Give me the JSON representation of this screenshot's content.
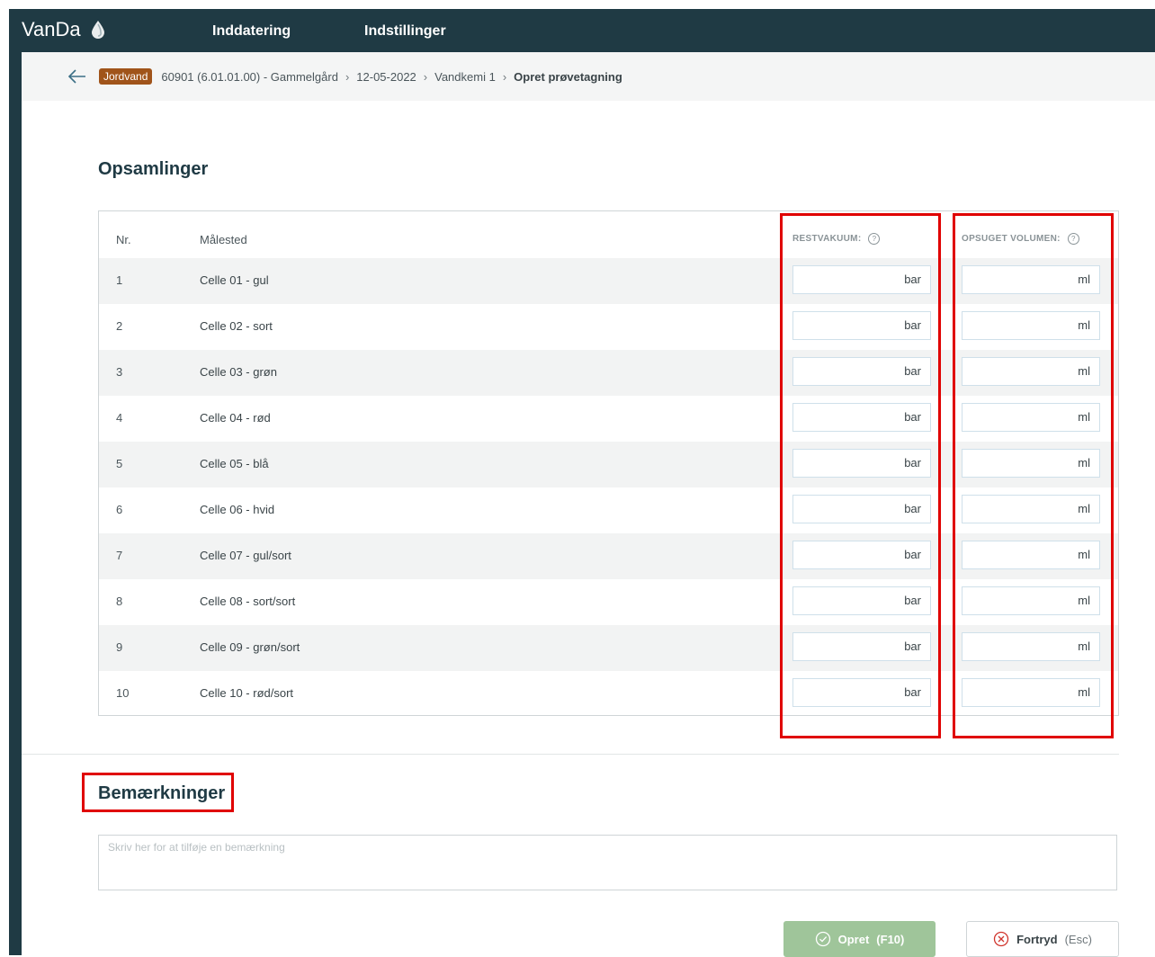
{
  "app": {
    "name": "VanDa"
  },
  "nav": {
    "items": [
      "Inddatering",
      "Indstillinger"
    ]
  },
  "breadcrumb": {
    "badge": "Jordvand",
    "parts": [
      "60901 (6.01.01.00) - Gammelgård",
      "12-05-2022",
      "Vandkemi 1"
    ],
    "current": "Opret prøvetagning"
  },
  "section1": {
    "title": "Opsamlinger"
  },
  "table": {
    "headers": {
      "nr": "Nr.",
      "malested": "Målested",
      "restvakuum": "RESTVAKUUM:",
      "opsuget": "OPSUGET VOLUMEN:"
    },
    "rows": [
      {
        "nr": "1",
        "name": "Celle 01 - gul",
        "unit_a": "bar",
        "unit_b": "ml"
      },
      {
        "nr": "2",
        "name": "Celle 02 - sort",
        "unit_a": "bar",
        "unit_b": "ml"
      },
      {
        "nr": "3",
        "name": "Celle 03 - grøn",
        "unit_a": "bar",
        "unit_b": "ml"
      },
      {
        "nr": "4",
        "name": "Celle 04 - rød",
        "unit_a": "bar",
        "unit_b": "ml"
      },
      {
        "nr": "5",
        "name": "Celle 05 - blå",
        "unit_a": "bar",
        "unit_b": "ml"
      },
      {
        "nr": "6",
        "name": "Celle 06 - hvid",
        "unit_a": "bar",
        "unit_b": "ml"
      },
      {
        "nr": "7",
        "name": "Celle 07 - gul/sort",
        "unit_a": "bar",
        "unit_b": "ml"
      },
      {
        "nr": "8",
        "name": "Celle 08 - sort/sort",
        "unit_a": "bar",
        "unit_b": "ml"
      },
      {
        "nr": "9",
        "name": "Celle 09 - grøn/sort",
        "unit_a": "bar",
        "unit_b": "ml"
      },
      {
        "nr": "10",
        "name": "Celle 10 - rød/sort",
        "unit_a": "bar",
        "unit_b": "ml"
      }
    ]
  },
  "section2": {
    "title": "Bemærkninger"
  },
  "remark": {
    "placeholder": "Skriv her for at tilføje en bemærkning"
  },
  "buttons": {
    "create_label": "Opret",
    "create_key": "(F10)",
    "cancel_label": "Fortryd",
    "cancel_key": "(Esc)"
  },
  "colors": {
    "header_bg": "#1f3a44",
    "badge": "#a0541a",
    "highlight": "#e00000",
    "create_btn": "#9fc59a"
  },
  "icons": {
    "logo": "water-drop-icon",
    "back": "arrow-left-icon",
    "help": "question-circle-icon",
    "create": "check-circle-icon",
    "cancel": "x-circle-icon"
  }
}
